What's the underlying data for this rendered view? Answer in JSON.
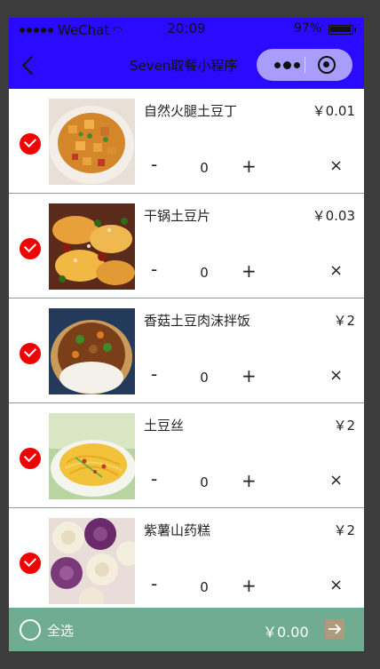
{
  "status_bar": {
    "carrier": "WeChat",
    "time": "20:09",
    "battery": "97%",
    "battery_level": 0.97
  },
  "nav": {
    "title": "Seven取餐小程序",
    "back_icon": "chevron-left-icon",
    "more_icon": "more-dots-icon",
    "close_icon": "target-close-icon"
  },
  "items": [
    {
      "name": "自然火腿土豆丁",
      "price": "￥0.01",
      "qty": "0",
      "minus": "-",
      "plus": "+",
      "delete": "×",
      "checked": true
    },
    {
      "name": "干锅土豆片",
      "price": "￥0.03",
      "qty": "0",
      "minus": "-",
      "plus": "+",
      "delete": "×",
      "checked": true
    },
    {
      "name": "香菇土豆肉沫拌饭",
      "price": "￥2",
      "qty": "0",
      "minus": "-",
      "plus": "+",
      "delete": "×",
      "checked": true
    },
    {
      "name": "土豆丝",
      "price": "￥2",
      "qty": "0",
      "minus": "-",
      "plus": "+",
      "delete": "×",
      "checked": true
    },
    {
      "name": "紫薯山药糕",
      "price": "￥2",
      "qty": "0",
      "minus": "-",
      "plus": "+",
      "delete": "×",
      "checked": true
    }
  ],
  "footer": {
    "select_all": "全选",
    "total": "￥0.00",
    "checkout_icon": "arrow-right-icon"
  },
  "colors": {
    "nav_bg": "#2b0bff",
    "check_red": "#f00000",
    "footer_green": "#6fac92",
    "divider": "#4ec08e"
  }
}
